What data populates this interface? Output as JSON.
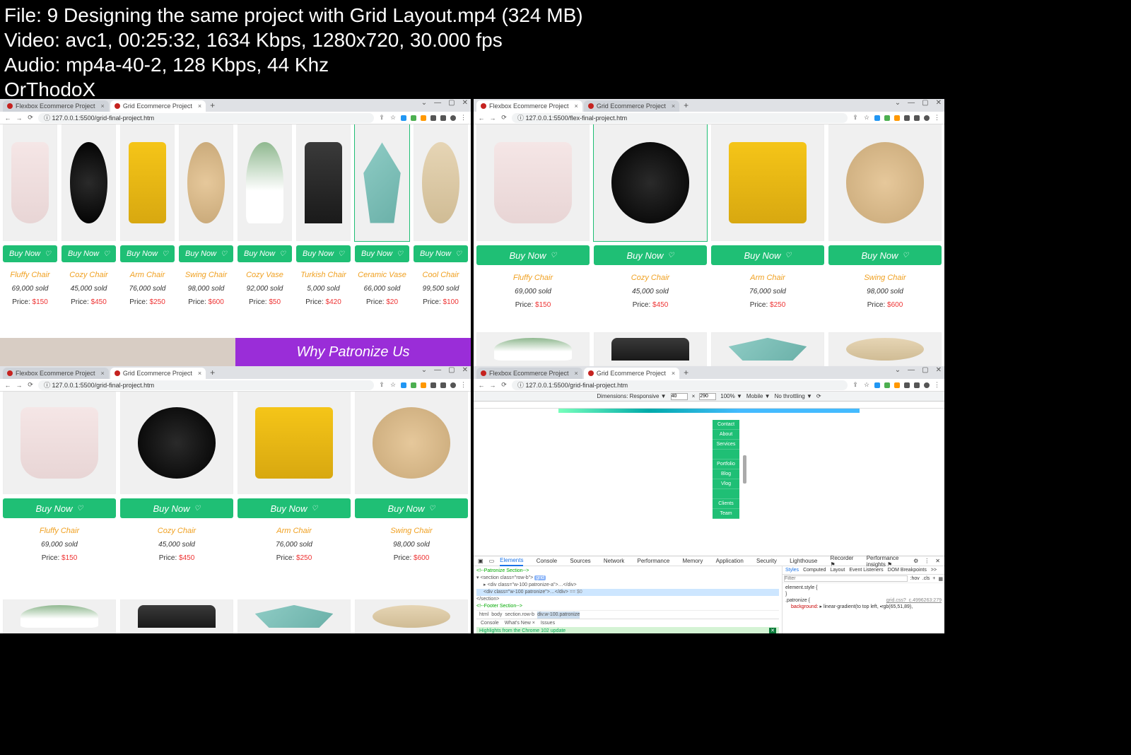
{
  "info": {
    "line1": "File: 9  Designing the same project with Grid Layout.mp4 (324 MB)",
    "line2": "Video: avc1, 00:25:32, 1634 Kbps, 1280x720, 30.000 fps",
    "line3": "Audio: mp4a-40-2, 128 Kbps, 44 Khz",
    "line4": "OrThodoX"
  },
  "browser": {
    "tab1": "Flexbox Ecommerce Project",
    "tab2": "Grid Ecommerce Project",
    "url_grid": "127.0.0.1:5500/grid-final-project.htm",
    "url_flex": "127.0.0.1:5500/flex-final-project.htm",
    "new_tab": "+",
    "close": "×",
    "nav_back": "←",
    "nav_fwd": "→",
    "nav_reload": "⟳",
    "info_icon": "ⓘ",
    "share": "⇪",
    "star": "☆"
  },
  "products8": [
    {
      "name": "Fluffy Chair",
      "sold": "69,000 sold",
      "price": "$150",
      "cls": "f-pink"
    },
    {
      "name": "Cozy Chair",
      "sold": "45,000 sold",
      "price": "$450",
      "cls": "f-black"
    },
    {
      "name": "Arm Chair",
      "sold": "76,000 sold",
      "price": "$250",
      "cls": "f-yellow"
    },
    {
      "name": "Swing Chair",
      "sold": "98,000 sold",
      "price": "$600",
      "cls": "f-wood"
    },
    {
      "name": "Cozy Vase",
      "sold": "92,000 sold",
      "price": "$50",
      "cls": "f-plant"
    },
    {
      "name": "Turkish Chair",
      "sold": "5,000 sold",
      "price": "$420",
      "cls": "f-dark"
    },
    {
      "name": "Ceramic Vase",
      "sold": "66,000 sold",
      "price": "$20",
      "cls": "f-teal"
    },
    {
      "name": "Cool Chair",
      "sold": "99,500 sold",
      "price": "$100",
      "cls": "f-table"
    }
  ],
  "products4": [
    {
      "name": "Fluffy Chair",
      "sold": "69,000 sold",
      "price": "$150",
      "cls": "f-pink"
    },
    {
      "name": "Cozy Chair",
      "sold": "45,000 sold",
      "price": "$450",
      "cls": "f-black"
    },
    {
      "name": "Arm Chair",
      "sold": "76,000 sold",
      "price": "$250",
      "cls": "f-yellow"
    },
    {
      "name": "Swing Chair",
      "sold": "98,000 sold",
      "price": "$600",
      "cls": "f-wood"
    }
  ],
  "row2_cls": [
    "f-plant",
    "f-dark",
    "f-teal",
    "f-table"
  ],
  "buy_label": "Buy Now",
  "price_label": "Price: ",
  "patronize": "Why Patronize Us",
  "devtools": {
    "dimensions": "Dimensions: Responsive ▼",
    "w": "40",
    "h": "290",
    "zoom": "100% ▼",
    "mobile": "Mobile ▼",
    "throttle": "No throttling ▼",
    "menu_items": [
      "Contact",
      "About",
      "Services",
      "",
      "Portfolio",
      "Blog",
      "Vlog",
      "",
      "Clients",
      "Team"
    ],
    "tabs": [
      "Elements",
      "Console",
      "Sources",
      "Network",
      "Performance",
      "Memory",
      "Application",
      "Security",
      "Lighthouse",
      "Recorder ⚑",
      "Performance insights ⚑"
    ],
    "side_tabs": [
      "Styles",
      "Computed",
      "Layout",
      "Event Listeners",
      "DOM Breakpoints",
      ">>"
    ],
    "filter": "Filter",
    "hov": ":hov",
    "cls": ".cls",
    "element_style": "element.style {",
    "brace": "}",
    "rule_sel": ".patronize {",
    "rule_src": "grid.css?_c.4996263:279",
    "rule_prop": "background:",
    "rule_val": "▸ linear-gradient(to top left, ▪rgb(65,51,89),",
    "html1_pre": "<!--Patronize Section-->",
    "html2_open": "▾ <section class=\"row-b\">",
    "html2_pin": "grid",
    "html3_open": "▸ <div class=\"w-100 patronize-a\">…</div>",
    "html4_open": "  <div class=\"w-100 patronize\">…</div>",
    "html4_eq": " == $0",
    "html5": "</section>",
    "html6": "<!--Footer Section-->",
    "breadcrumb": [
      "html",
      "body",
      "section.row-b",
      "div.w-100.patronize"
    ],
    "console_tabs": [
      "Console",
      "What's New ×",
      "Issues"
    ],
    "highlight": "Highlights from the Chrome 102 update"
  }
}
